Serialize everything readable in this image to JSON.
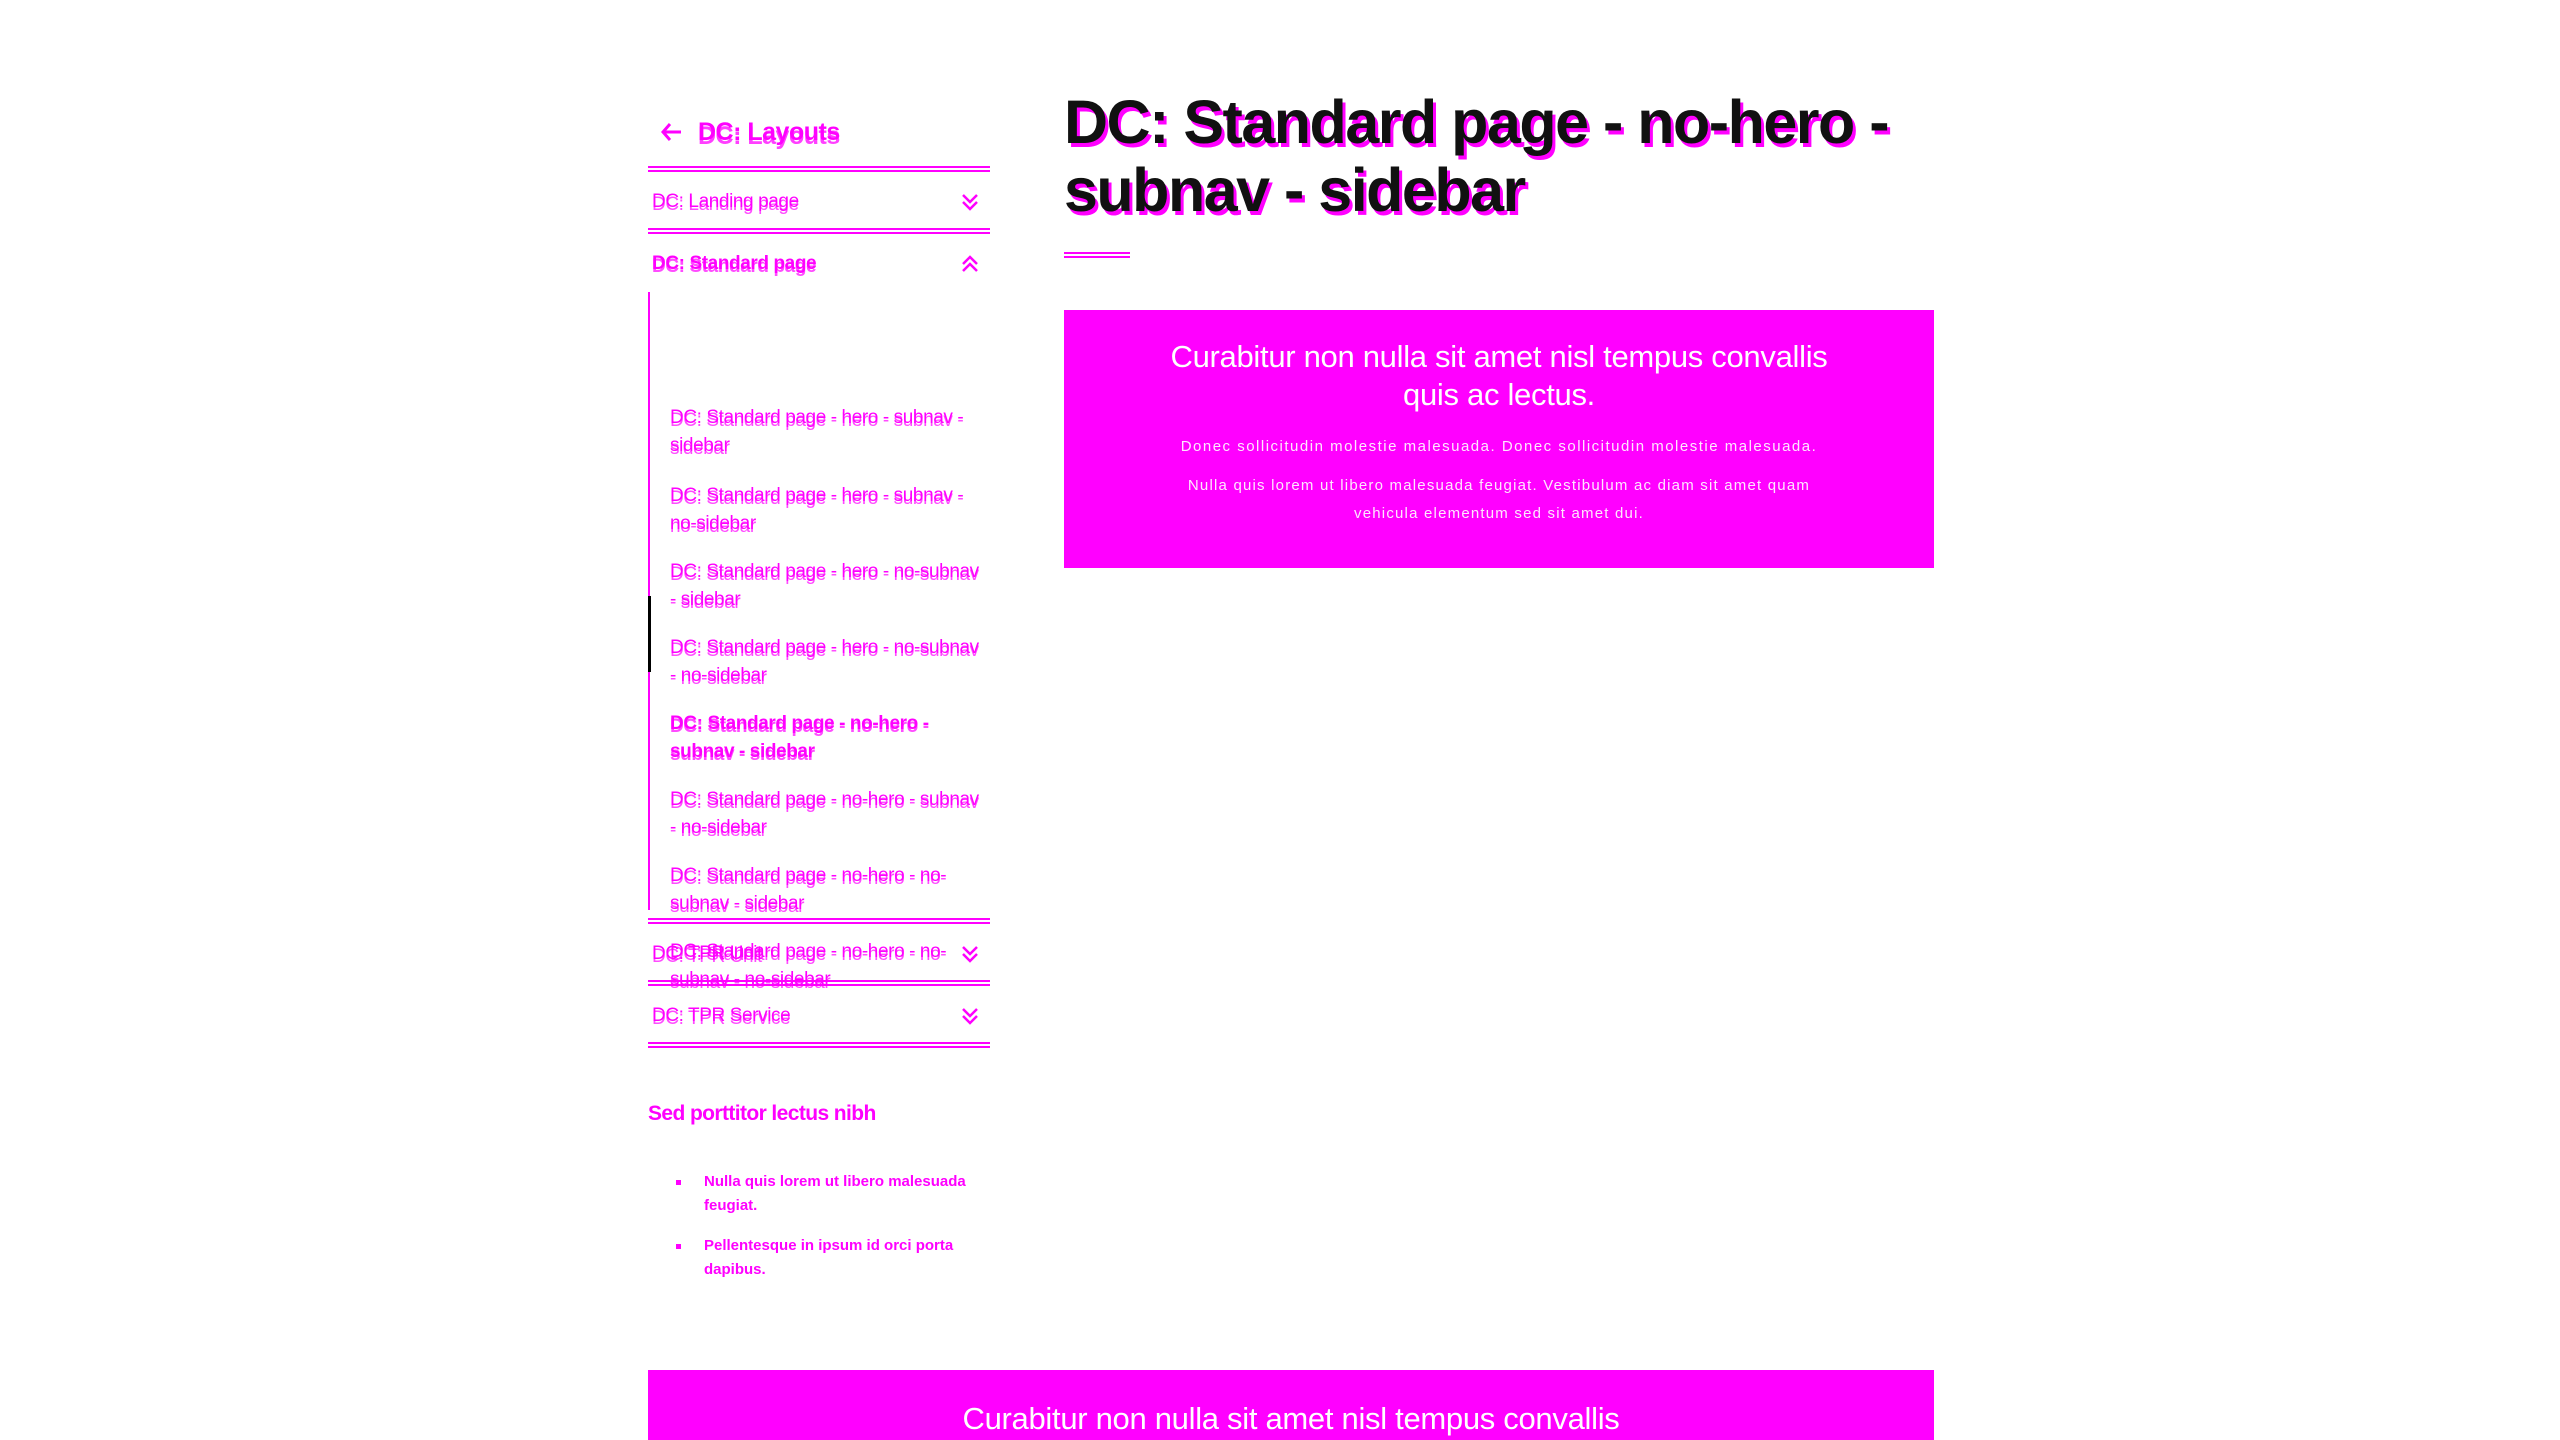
{
  "sidebar": {
    "back_label": "DC: Layouts",
    "sections": [
      {
        "label": "DC: Landing page",
        "expanded": false
      },
      {
        "label": "DC: Standard page",
        "expanded": true
      },
      {
        "label": "DC: TPR Unit",
        "expanded": false
      },
      {
        "label": "DC: TPR Service",
        "expanded": false
      }
    ],
    "subnav": [
      "DC: Standard page - hero - subnav - sidebar",
      "DC: Standard page - hero - subnav - no-sidebar",
      "DC: Standard page - hero - no-subnav - sidebar",
      "DC: Standard page - hero - no-subnav - no-sidebar",
      "DC: Standard page - no-hero - subnav - sidebar",
      "DC: Standard page - no-hero - subnav - no-sidebar",
      "DC: Standard page - no-hero - no-subnav - sidebar",
      "DC: Standard page - no-hero - no-subnav - no-sidebar"
    ],
    "active_index": 4,
    "widget": {
      "title": "Sed porttitor lectus nibh",
      "items": [
        "Nulla quis lorem ut libero malesuada feugiat.",
        "Pellentesque in ipsum id orci porta dapibus."
      ]
    }
  },
  "main": {
    "title": "DC: Standard page - no-hero - subnav - sidebar",
    "callout": {
      "lead": "Curabitur non nulla sit amet nisl tempus convallis quis ac lectus.",
      "p1": "Donec sollicitudin molestie malesuada. Donec sollicitudin molestie malesuada.",
      "p2": "Nulla quis lorem ut libero malesuada feugiat. Vestibulum ac diam sit amet quam vehicula elementum sed sit amet dui."
    },
    "bottom_callout": {
      "lead": "Curabitur non nulla sit amet nisl tempus convallis quis ac lectus."
    }
  },
  "colors": {
    "accent": "#ff00ff",
    "text_dark": "#111111",
    "background": "#ffffff"
  },
  "icons": {
    "back": "arrow-left-icon",
    "collapsed": "chevron-double-down-icon",
    "expanded": "chevron-double-up-icon"
  }
}
